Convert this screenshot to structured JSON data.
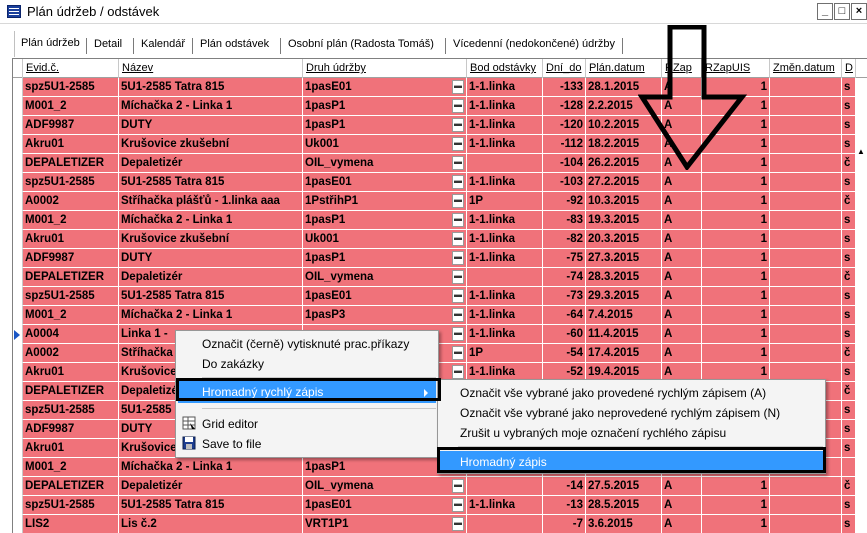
{
  "window": {
    "title": "Plán údržeb / odstávek",
    "buttons": [
      "_",
      "□",
      "×"
    ]
  },
  "tabs": [
    {
      "label": "Plán údržeb",
      "active": true
    },
    {
      "label": "Detail",
      "active": false
    },
    {
      "label": "Kalendář",
      "active": false
    },
    {
      "label": "Plán odstávek",
      "active": false
    },
    {
      "label": "Osobní plán (Radosta Tomáš)",
      "active": false
    },
    {
      "label": "Vícedenní (nedokončené) údržby",
      "active": false
    }
  ],
  "grid": {
    "columns": [
      "Evid.č.",
      "Název",
      "Druh údržby",
      "Bod odstávky",
      "Dní_do",
      "Plán.datum",
      "RZap",
      "RZapUIS",
      "Změn.datum",
      "D"
    ],
    "row_color": "#f0727a",
    "selected_row_index": 13,
    "rows": [
      {
        "evid": "spz5U1-2585",
        "nazev": "5U1-2585 Tatra 815",
        "druh": "1pasE01",
        "bod": "1-1.linka",
        "dni": "-133",
        "datum": "28.1.2015",
        "rzap": "A",
        "rzapuis": "1",
        "d": "s"
      },
      {
        "evid": "M001_2",
        "nazev": "Míchačka 2 - Linka 1",
        "druh": "1pasP1",
        "bod": "1-1.linka",
        "dni": "-128",
        "datum": "2.2.2015",
        "rzap": "A",
        "rzapuis": "1",
        "d": "s"
      },
      {
        "evid": "ADF9987",
        "nazev": "DUTY",
        "druh": "1pasP1",
        "bod": "1-1.linka",
        "dni": "-120",
        "datum": "10.2.2015",
        "rzap": "A",
        "rzapuis": "1",
        "d": "s"
      },
      {
        "evid": "Akru01",
        "nazev": "Krušovice zkušební",
        "druh": "Uk001",
        "bod": "1-1.linka",
        "dni": "-112",
        "datum": "18.2.2015",
        "rzap": "A",
        "rzapuis": "1",
        "d": "s"
      },
      {
        "evid": "DEPALETIZER",
        "nazev": "Depaletizér",
        "druh": "OIL_vymena",
        "bod": "",
        "dni": "-104",
        "datum": "26.2.2015",
        "rzap": "A",
        "rzapuis": "1",
        "d": "č"
      },
      {
        "evid": "spz5U1-2585",
        "nazev": "5U1-2585 Tatra 815",
        "druh": "1pasE01",
        "bod": "1-1.linka",
        "dni": "-103",
        "datum": "27.2.2015",
        "rzap": "A",
        "rzapuis": "1",
        "d": "s"
      },
      {
        "evid": "A0002",
        "nazev": "Stříhačka plášťů - 1.linka aaa",
        "druh": "1PstřihP1",
        "bod": "1P",
        "dni": "-92",
        "datum": "10.3.2015",
        "rzap": "A",
        "rzapuis": "1",
        "d": "č"
      },
      {
        "evid": "M001_2",
        "nazev": "Míchačka 2 - Linka 1",
        "druh": "1pasP1",
        "bod": "1-1.linka",
        "dni": "-83",
        "datum": "19.3.2015",
        "rzap": "A",
        "rzapuis": "1",
        "d": "s"
      },
      {
        "evid": "Akru01",
        "nazev": "Krušovice zkušební",
        "druh": "Uk001",
        "bod": "1-1.linka",
        "dni": "-82",
        "datum": "20.3.2015",
        "rzap": "A",
        "rzapuis": "1",
        "d": "s"
      },
      {
        "evid": "ADF9987",
        "nazev": "DUTY",
        "druh": "1pasP1",
        "bod": "1-1.linka",
        "dni": "-75",
        "datum": "27.3.2015",
        "rzap": "A",
        "rzapuis": "1",
        "d": "s"
      },
      {
        "evid": "DEPALETIZER",
        "nazev": "Depaletizér",
        "druh": "OIL_vymena",
        "bod": "",
        "dni": "-74",
        "datum": "28.3.2015",
        "rzap": "A",
        "rzapuis": "1",
        "d": "č"
      },
      {
        "evid": "spz5U1-2585",
        "nazev": "5U1-2585 Tatra 815",
        "druh": "1pasE01",
        "bod": "1-1.linka",
        "dni": "-73",
        "datum": "29.3.2015",
        "rzap": "A",
        "rzapuis": "1",
        "d": "s"
      },
      {
        "evid": "M001_2",
        "nazev": "Míchačka 2 - Linka 1",
        "druh": "1pasP3",
        "bod": "1-1.linka",
        "dni": "-64",
        "datum": "7.4.2015",
        "rzap": "A",
        "rzapuis": "1",
        "d": "s"
      },
      {
        "evid": "A0004",
        "nazev": "Linka 1 -",
        "druh": "",
        "bod": "1-1.linka",
        "dni": "-60",
        "datum": "11.4.2015",
        "rzap": "A",
        "rzapuis": "1",
        "d": "s"
      },
      {
        "evid": "A0002",
        "nazev": "Stříhačka",
        "druh": "",
        "bod": "1P",
        "dni": "-54",
        "datum": "17.4.2015",
        "rzap": "A",
        "rzapuis": "1",
        "d": "č"
      },
      {
        "evid": "Akru01",
        "nazev": "Krušovice",
        "druh": "",
        "bod": "1-1.linka",
        "dni": "-52",
        "datum": "19.4.2015",
        "rzap": "A",
        "rzapuis": "1",
        "d": "s"
      },
      {
        "evid": "DEPALETIZER",
        "nazev": "Depaletizér",
        "druh": "",
        "bod": "",
        "dni": "",
        "datum": "",
        "rzap": "",
        "rzapuis": "",
        "d": "č"
      },
      {
        "evid": "spz5U1-2585",
        "nazev": "5U1-2585",
        "druh": "",
        "bod": "",
        "dni": "",
        "datum": "",
        "rzap": "",
        "rzapuis": "",
        "d": "s"
      },
      {
        "evid": "ADF9987",
        "nazev": "DUTY",
        "druh": "",
        "bod": "",
        "dni": "",
        "datum": "",
        "rzap": "",
        "rzapuis": "",
        "d": "s"
      },
      {
        "evid": "Akru01",
        "nazev": "Krušovice zkušební",
        "druh": "",
        "bod": "",
        "dni": "",
        "datum": "",
        "rzap": "",
        "rzapuis": "",
        "d": "s"
      },
      {
        "evid": "M001_2",
        "nazev": "Míchačka 2 - Linka 1",
        "druh": "1pasP1",
        "bod": "",
        "dni": "",
        "datum": "",
        "rzap": "",
        "rzapuis": "",
        "d": ""
      },
      {
        "evid": "DEPALETIZER",
        "nazev": "Depaletizér",
        "druh": "OIL_vymena",
        "bod": "",
        "dni": "-14",
        "datum": "27.5.2015",
        "rzap": "A",
        "rzapuis": "1",
        "d": "č"
      },
      {
        "evid": "spz5U1-2585",
        "nazev": "5U1-2585 Tatra 815",
        "druh": "1pasE01",
        "bod": "1-1.linka",
        "dni": "-13",
        "datum": "28.5.2015",
        "rzap": "A",
        "rzapuis": "1",
        "d": "s"
      },
      {
        "evid": "LIS2",
        "nazev": "Lis č.2",
        "druh": "VRT1P1",
        "bod": "",
        "dni": "-7",
        "datum": "3.6.2015",
        "rzap": "A",
        "rzapuis": "1",
        "d": "s"
      }
    ]
  },
  "context_menu": {
    "items": [
      {
        "label": "Označit (černě) vytisknuté prac.příkazy",
        "icon": ""
      },
      {
        "label": "Do zakázky",
        "icon": ""
      },
      {
        "label": "Hromadný rychlý zápis",
        "icon": "",
        "submenu": true,
        "highlighted": true
      },
      {
        "label": "Grid editor",
        "icon": "grid-editor-icon"
      },
      {
        "label": "Save to file",
        "icon": "save-floppy-icon"
      }
    ]
  },
  "submenu": {
    "items": [
      {
        "label": "Označit vše vybrané jako provedené rychlým zápisem (A)"
      },
      {
        "label": "Označit vše vybrané jako neprovedené rychlým zápisem  (N)"
      },
      {
        "label": "Zrušit u vybraných moje označení rychlého zápisu"
      },
      {
        "label": "Hromadný zápis",
        "highlighted": true
      }
    ]
  },
  "annotations": {
    "arrow_color": "#000000",
    "highlight_color": "#3399ff"
  }
}
